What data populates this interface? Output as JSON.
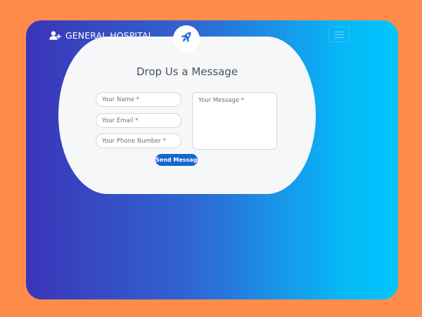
{
  "navbar": {
    "brand": "GENERAL HOSPITAL",
    "brand_icon": "user-plus-icon",
    "toggle_icon": "hamburger-menu-icon"
  },
  "contact_form": {
    "icon": "rocket-icon",
    "title": "Drop Us a Message",
    "name_placeholder": "Your Name *",
    "email_placeholder": "Your Email *",
    "phone_placeholder": "Your Phone Number *",
    "message_placeholder": "Your Message *",
    "submit_label": "Send Message"
  },
  "colors": {
    "page_background": "#fe8c4b",
    "gradient_start": "#3b35b8",
    "gradient_end": "#00c6ff",
    "card_background": "#f6f7f9",
    "button": "#1766d1",
    "rocket": "#1f6fd6"
  }
}
